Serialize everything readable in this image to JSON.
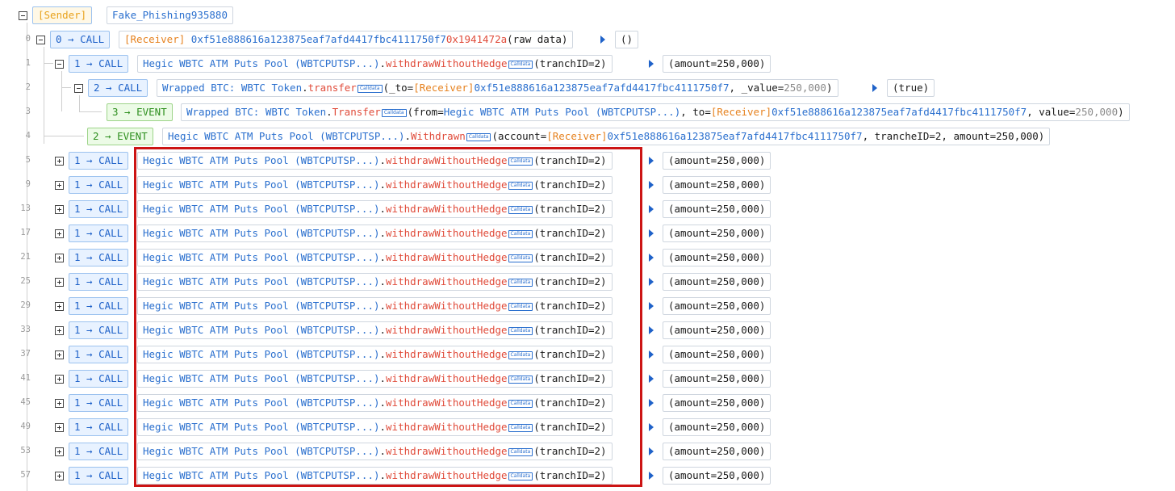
{
  "header": {
    "sender_label": "[Sender]",
    "sender_name": "Fake_Phishing935880"
  },
  "labels": {
    "receiver": "[Receiver]",
    "receiver_addr": "0xf51e888616a123875eaf7afd4417fbc4111750f7",
    "pool": "Hegic WBTC ATM Puts Pool (WBTCPUTSP...)",
    "wbtc": "Wrapped BTC: WBTC Token",
    "calldata": "Calldata",
    "withdraw_fn": "withdrawWithoutHedge",
    "withdraw_args": "(tranchID=2)",
    "amount_ret": "(amount=250,000)"
  },
  "rows": {
    "r0": {
      "line": "0",
      "badge": "0 → CALL",
      "selector": "0x1941472a",
      "args": "(raw data)",
      "ret": "()"
    },
    "r1": {
      "line": "1",
      "badge": "1 → CALL"
    },
    "r2": {
      "line": "2",
      "badge": "2 → CALL",
      "fn": "transfer",
      "arg_to": "(_to=",
      "arg_value": ", _value=",
      "value": "250,000",
      "close": ")",
      "ret": "(true)"
    },
    "r3": {
      "line": "3",
      "badge": "3 → EVENT",
      "fn": "Transfer",
      "arg_from": "(from=",
      "arg_to": ", to=",
      "arg_value": ", value=",
      "value": "250,000",
      "close": ")"
    },
    "r4": {
      "line": "4",
      "badge": "2 → EVENT",
      "fn": "Withdrawn",
      "arg_account": "(account=",
      "tail": ", trancheID=2, amount=250,000)"
    }
  },
  "repeat_rows": [
    {
      "line": "5",
      "badge": "1 → CALL"
    },
    {
      "line": "9",
      "badge": "1 → CALL"
    },
    {
      "line": "13",
      "badge": "1 → CALL"
    },
    {
      "line": "17",
      "badge": "1 → CALL"
    },
    {
      "line": "21",
      "badge": "1 → CALL"
    },
    {
      "line": "25",
      "badge": "1 → CALL"
    },
    {
      "line": "29",
      "badge": "1 → CALL"
    },
    {
      "line": "33",
      "badge": "1 → CALL"
    },
    {
      "line": "37",
      "badge": "1 → CALL"
    },
    {
      "line": "41",
      "badge": "1 → CALL"
    },
    {
      "line": "45",
      "badge": "1 → CALL"
    },
    {
      "line": "49",
      "badge": "1 → CALL"
    },
    {
      "line": "53",
      "badge": "1 → CALL"
    },
    {
      "line": "57",
      "badge": "1 → CALL"
    }
  ],
  "colors": {
    "call": "#1f62c9",
    "event": "#2e8f1f",
    "receiver": "#e6821f",
    "method": "#e04b3a",
    "highlight": "#cc1414"
  }
}
